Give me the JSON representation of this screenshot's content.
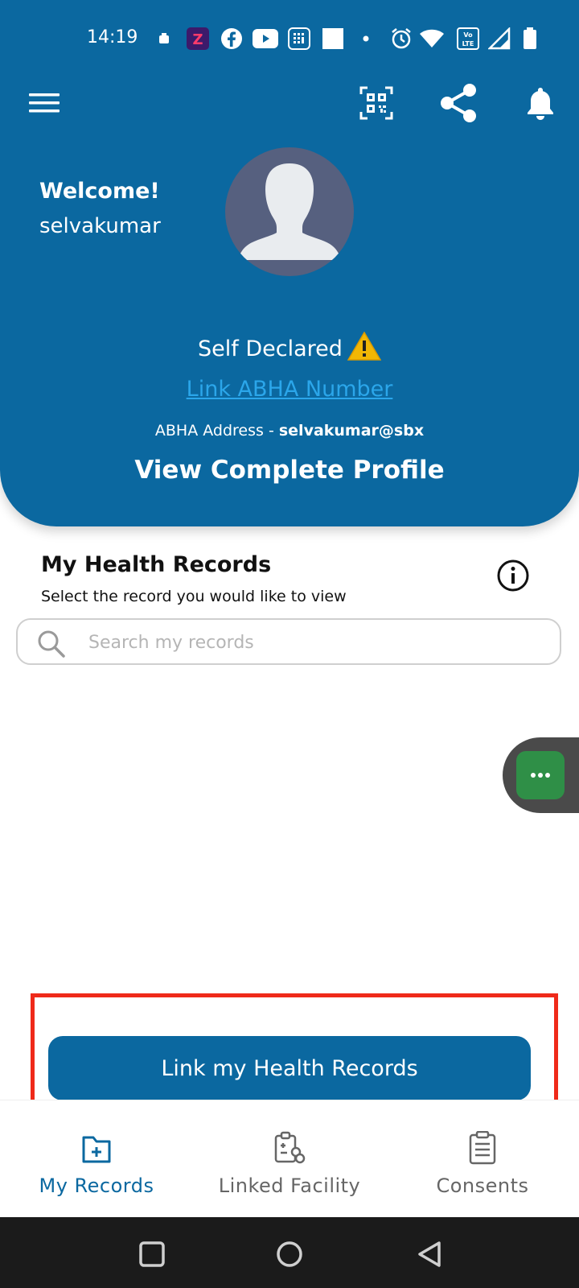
{
  "status_bar": {
    "time": "14:19",
    "icons": [
      "sim-icon",
      "zomato-icon",
      "facebook-icon",
      "youtube-icon",
      "calculator-icon",
      "square-icon",
      "dot-icon",
      "alarm-icon",
      "wifi-icon",
      "volte-icon",
      "signal-icon",
      "battery-icon"
    ]
  },
  "toolbar": {
    "menu_icon": "hamburger-menu-icon",
    "qr_icon": "qr-code-icon",
    "share_icon": "share-icon",
    "notification_icon": "bell-icon"
  },
  "profile": {
    "welcome": "Welcome!",
    "username": "selvakumar",
    "status_label": "Self Declared",
    "link_abha": "Link ABHA Number",
    "abha_address_label": "ABHA Address - ",
    "abha_address_value": "selvakumar@sbx",
    "view_profile": "View Complete Profile"
  },
  "records": {
    "title": "My Health Records",
    "subtitle": "Select the record you would like to view",
    "search_placeholder": "Search my records",
    "search_value": ""
  },
  "actions": {
    "link_records": "Link my Health Records"
  },
  "bottom_nav": {
    "items": [
      {
        "label": "My Records",
        "icon": "records-icon",
        "active": true
      },
      {
        "label": "Linked Facility",
        "icon": "linked-facility-icon",
        "active": false
      },
      {
        "label": "Consents",
        "icon": "consents-clipboard-icon",
        "active": false
      }
    ]
  },
  "colors": {
    "primary": "#0b68a0",
    "link": "#2ba6ea",
    "highlight": "#ef2a1a",
    "chat": "#2f8f47",
    "nav_inactive": "#666666"
  }
}
